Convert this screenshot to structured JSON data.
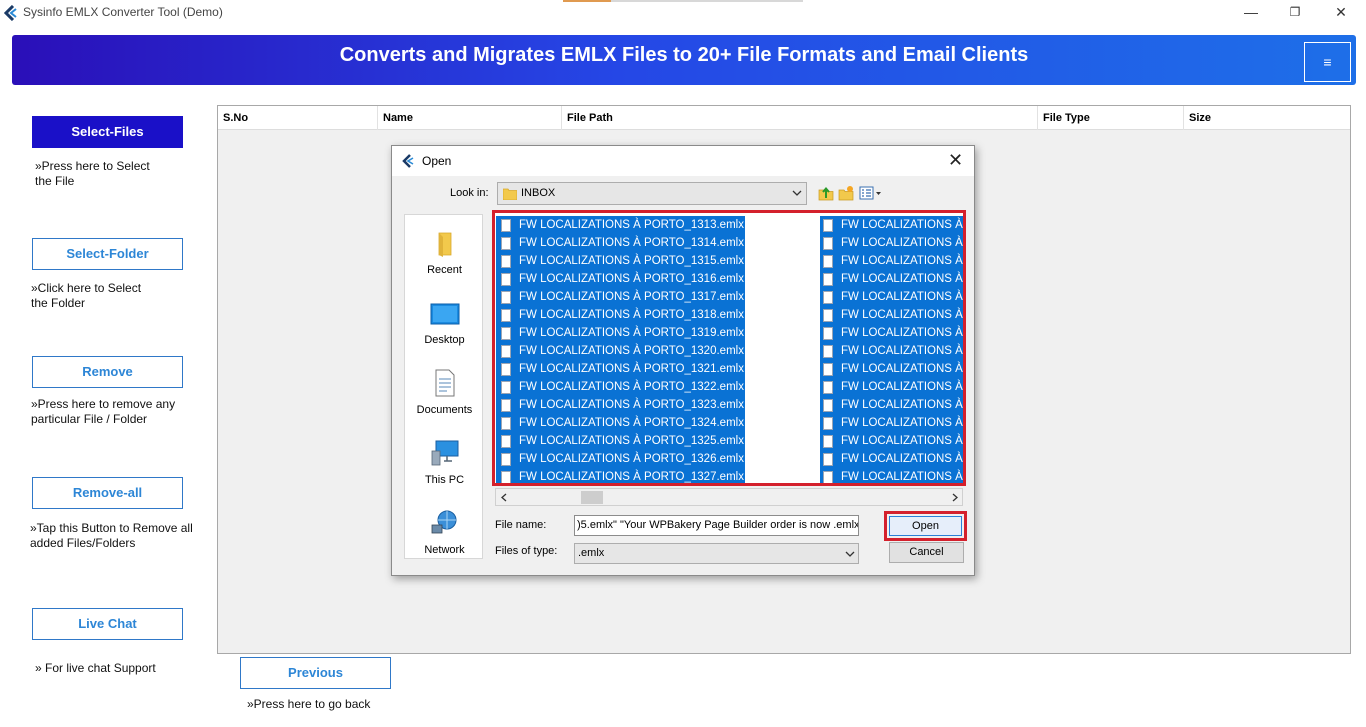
{
  "app": {
    "title": "Sysinfo EMLX Converter Tool (Demo)",
    "window_controls": {
      "minimize": "—",
      "restore": "❐",
      "close": "✕"
    }
  },
  "banner": {
    "text": "Converts and Migrates EMLX Files to 20+ File Formats and Email Clients",
    "menu_icon": "≡"
  },
  "sidebar": {
    "select_files": {
      "label": "Select-Files",
      "note_line1": "»Press here to Select",
      "note_line2": "the File"
    },
    "select_folder": {
      "label": "Select-Folder",
      "note_line1": "»Click here to Select",
      "note_line2": "the Folder"
    },
    "remove": {
      "label": "Remove",
      "note_line1": "»Press here to remove any",
      "note_line2": "particular File / Folder"
    },
    "remove_all": {
      "label": "Remove-all",
      "note_line1": "»Tap this Button to Remove all",
      "note_line2": "added Files/Folders"
    },
    "live_chat": {
      "label": "Live Chat",
      "note_line1": "» For live chat Support"
    }
  },
  "table": {
    "columns": [
      "S.No",
      "Name",
      "File Path",
      "File Type",
      "Size"
    ]
  },
  "footer": {
    "previous_label": "Previous",
    "previous_note": "»Press here to go back"
  },
  "dialog": {
    "title": "Open",
    "close": "✕",
    "look_in_label": "Look in:",
    "look_in_value": "INBOX",
    "places": [
      "Recent",
      "Desktop",
      "Documents",
      "This PC",
      "Network"
    ],
    "files_col1": [
      "FW  LOCALIZATIONS À PORTO_1313.emlx",
      "FW  LOCALIZATIONS À PORTO_1314.emlx",
      "FW  LOCALIZATIONS À PORTO_1315.emlx",
      "FW  LOCALIZATIONS À PORTO_1316.emlx",
      "FW  LOCALIZATIONS À PORTO_1317.emlx",
      "FW  LOCALIZATIONS À PORTO_1318.emlx",
      "FW  LOCALIZATIONS À PORTO_1319.emlx",
      "FW  LOCALIZATIONS À PORTO_1320.emlx",
      "FW  LOCALIZATIONS À PORTO_1321.emlx",
      "FW  LOCALIZATIONS À PORTO_1322.emlx",
      "FW  LOCALIZATIONS À PORTO_1323.emlx",
      "FW  LOCALIZATIONS À PORTO_1324.emlx",
      "FW  LOCALIZATIONS À PORTO_1325.emlx",
      "FW  LOCALIZATIONS À PORTO_1326.emlx",
      "FW  LOCALIZATIONS À PORTO_1327.emlx"
    ],
    "files_col2": [
      "FW  LOCALIZATIONS À",
      "FW  LOCALIZATIONS À",
      "FW  LOCALIZATIONS À",
      "FW  LOCALIZATIONS À",
      "FW  LOCALIZATIONS À",
      "FW  LOCALIZATIONS À",
      "FW  LOCALIZATIONS À",
      "FW  LOCALIZATIONS À",
      "FW  LOCALIZATIONS À",
      "FW  LOCALIZATIONS À",
      "FW  LOCALIZATIONS À",
      "FW  LOCALIZATIONS À",
      "FW  LOCALIZATIONS À",
      "FW  LOCALIZATIONS À",
      "FW  LOCALIZATIONS À"
    ],
    "file_name_label": "File name:",
    "file_name_value": ")5.emlx\" \"Your WPBakery Page Builder order is now .emlx\"",
    "files_of_type_label": "Files of type:",
    "files_of_type_value": ".emlx",
    "open_label": "Open",
    "cancel_label": "Cancel"
  },
  "colors": {
    "banner_start": "#2a0fb8",
    "banner_end": "#1e6fe8",
    "selection": "#0a72d4",
    "highlight_box": "#d4202c",
    "side_button_text": "#2d86d6"
  }
}
